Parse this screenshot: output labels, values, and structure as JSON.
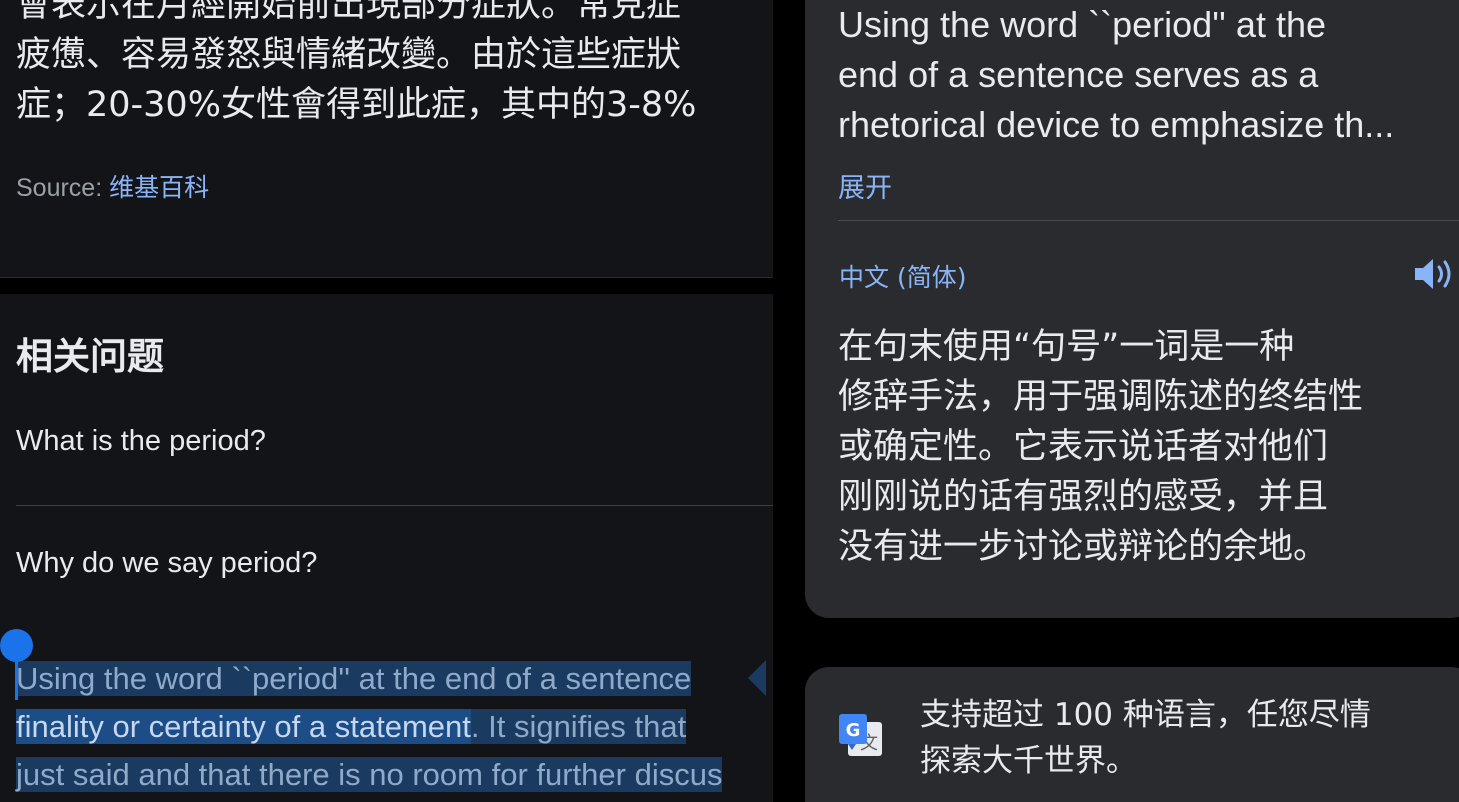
{
  "left": {
    "zh_body_lines": [
      "會表示在月經開始前出現部分症狀。常見症",
      "疲憊、容易發怒與情緒改變。由於這些症狀",
      "症；20-30%女性會得到此症，其中的3-8%"
    ],
    "source_label": "Source:",
    "source_link": "维基百科",
    "related_title": "相关问题",
    "questions": [
      "What is the period?",
      "Why do we say period?"
    ],
    "selection": {
      "line1": "Using the word ``period'' at the end of a sentence",
      "line2_strong": "finality or certainty of a statement",
      "line2_rest": ". It signifies that",
      "line3": "just said and that there is no room for further discus"
    }
  },
  "right": {
    "source_lines": [
      "Using the word ``period'' at the",
      "end of a sentence serves as a",
      "rhetorical device to emphasize th..."
    ],
    "expand_label": "展开",
    "target_language": "中文 (简体)",
    "translation_lines": [
      "在句末使用“句号”一词是一种",
      "修辞手法，用于强调陈述的终结性",
      "或确定性。它表示说话者对他们",
      "刚刚说的话有强烈的感受，并且",
      "没有进一步讨论或辩论的余地。"
    ],
    "promo_lines": [
      "支持超过 100 种语言，任您尽情",
      "探索大千世界。"
    ],
    "icons": {
      "speaker": "speaker-icon",
      "logo": "google-translate-icon"
    }
  },
  "colors": {
    "accent": "#8ab4f8",
    "selection_handle": "#1a73e8"
  }
}
